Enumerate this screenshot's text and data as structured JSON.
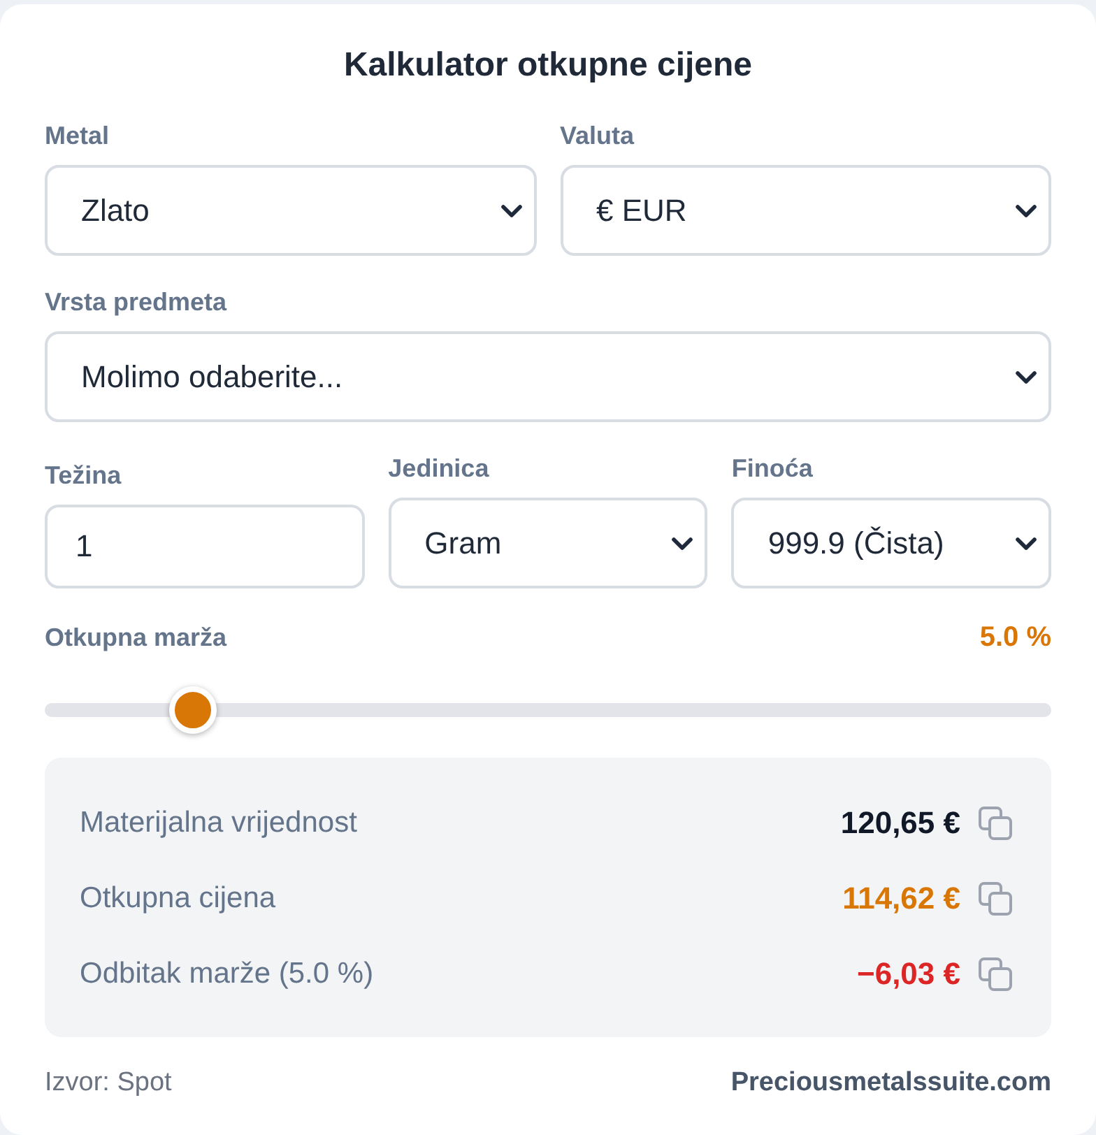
{
  "title": "Kalkulator otkupne cijene",
  "rows": [
    {
      "fields": [
        {
          "kind": "select",
          "label": "Metal",
          "value": "Zlato"
        },
        {
          "kind": "select",
          "label": "Valuta",
          "value": "€ EUR"
        }
      ]
    },
    {
      "fields": [
        {
          "kind": "select",
          "label": "Vrsta predmeta",
          "value": "Molimo odaberite..."
        }
      ]
    },
    {
      "fields": [
        {
          "kind": "input",
          "label": "Težina",
          "value": "1"
        },
        {
          "kind": "select",
          "label": "Jedinica",
          "value": "Gram"
        },
        {
          "kind": "select",
          "label": "Finoća",
          "value": "999.9 (Čista)"
        }
      ]
    }
  ],
  "margin": {
    "label": "Otkupna marža",
    "reading": "5.0 %",
    "level": 0.13
  },
  "results": [
    {
      "label": "Materijalna vrijednost",
      "value": "120,65 €",
      "color": "#111827"
    },
    {
      "label": "Otkupna cijena",
      "value": "114,62 €",
      "color": "#d97706"
    },
    {
      "label": "Odbitak marže (5.0 %)",
      "value": "−6,03 €",
      "color": "#dc2626"
    }
  ],
  "footer": {
    "source": "Izvor: Spot",
    "link": "Preciousmetalssuite.com"
  }
}
